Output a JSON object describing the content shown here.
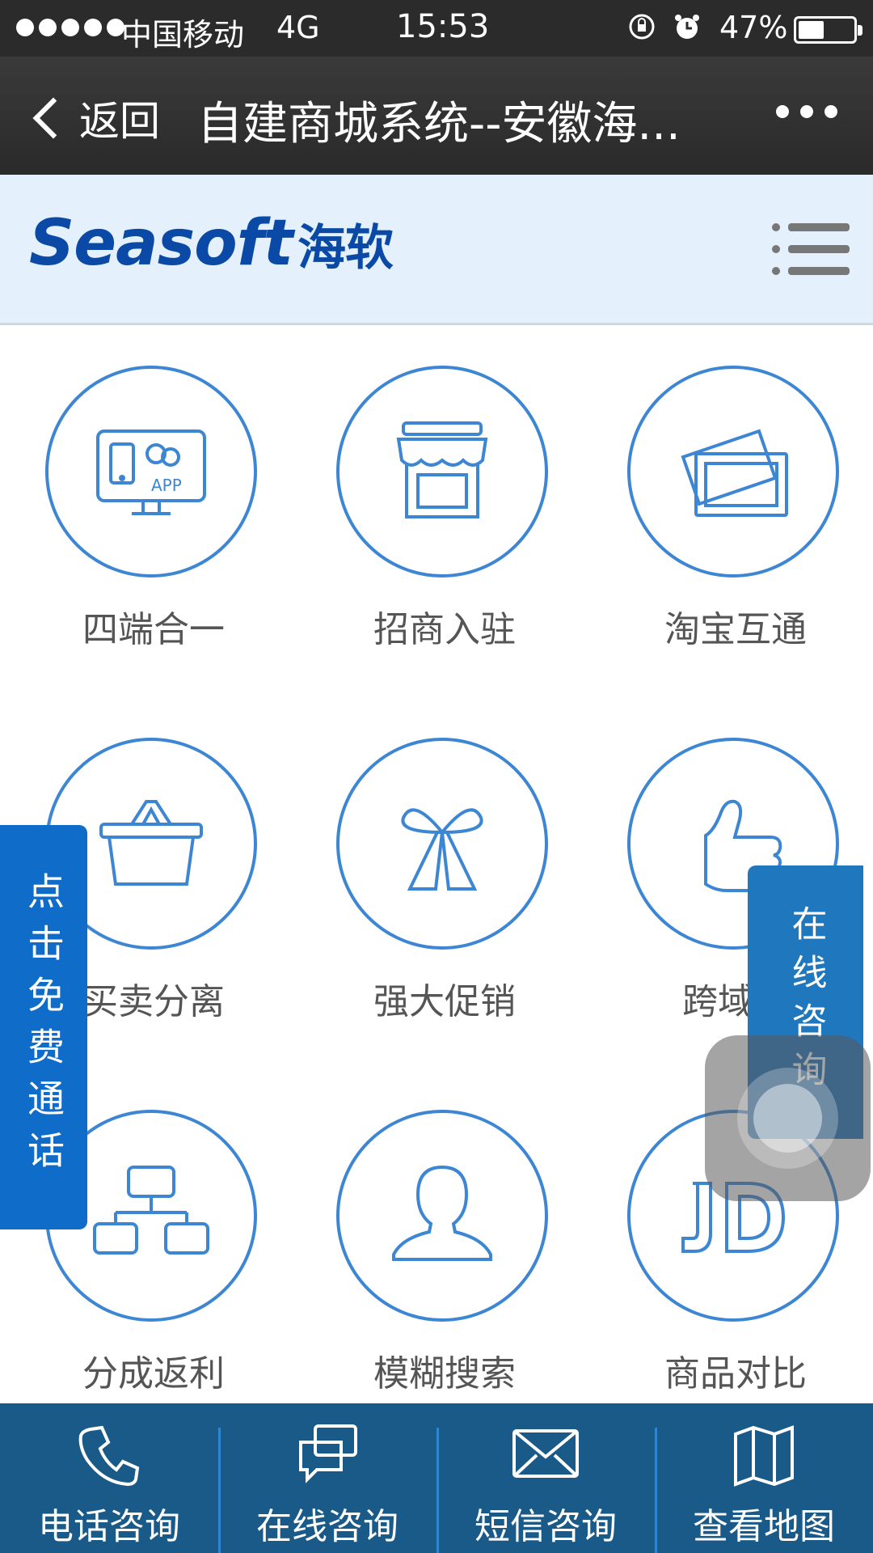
{
  "status_bar": {
    "carrier": "中国移动",
    "network": "4G",
    "time": "15:53",
    "battery": "47%",
    "battery_level": 0.47
  },
  "nav": {
    "back_label": "返回",
    "title": "自建商城系统--安徽海..."
  },
  "header": {
    "logo_en": "Seasoft",
    "logo_cn": "海软",
    "brand_color": "#0a4aa6"
  },
  "features": [
    {
      "label": "四端合一",
      "icon": "multi-device-icon"
    },
    {
      "label": "招商入驻",
      "icon": "storefront-icon"
    },
    {
      "label": "淘宝互通",
      "icon": "photo-frames-icon"
    },
    {
      "label": "买卖分离",
      "icon": "basket-icon"
    },
    {
      "label": "强大促销",
      "icon": "gift-bow-icon"
    },
    {
      "label": "跨域分",
      "icon": "thumbs-up-icon"
    },
    {
      "label": "分成返利",
      "icon": "org-chart-icon"
    },
    {
      "label": "模糊搜索",
      "icon": "user-silhouette-icon"
    },
    {
      "label": "商品对比",
      "icon": "jd-logo-icon"
    }
  ],
  "floats": {
    "free_call": "点击免费通话",
    "online_consult": "在线咨询"
  },
  "bottom_tabs": [
    {
      "label": "电话咨询",
      "icon": "phone-icon"
    },
    {
      "label": "在线咨询",
      "icon": "chat-bubbles-icon"
    },
    {
      "label": "短信咨询",
      "icon": "envelope-icon"
    },
    {
      "label": "查看地图",
      "icon": "map-icon"
    }
  ],
  "colors": {
    "accent": "#3d86d3",
    "bottom_bar": "#1a5a88",
    "float_blue": "#0f6cc8"
  }
}
